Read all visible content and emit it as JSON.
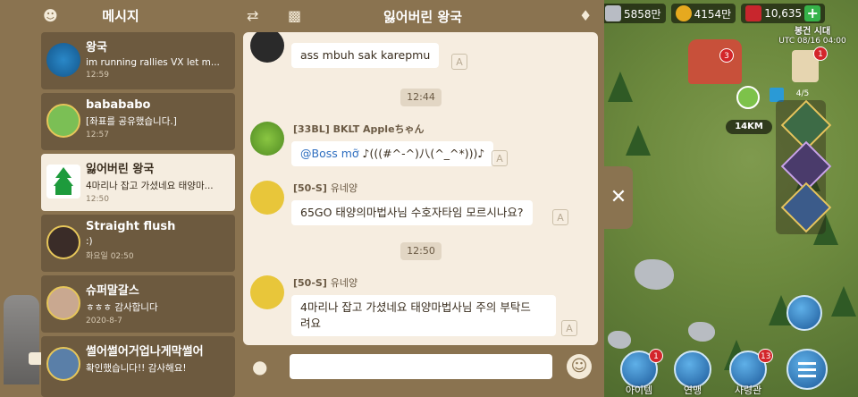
{
  "left_panel": {
    "title": "메시지",
    "conversations": [
      {
        "name": "왕국",
        "preview": "im running rallies VX let m...",
        "time": "12:59"
      },
      {
        "name": "babababo",
        "preview": "[좌표를 공유했습니다.]",
        "time": "12:57"
      },
      {
        "name": "잃어버린 왕국",
        "preview": "4마리나 잡고 가셨네요 태양마...",
        "time": "12:50"
      },
      {
        "name": "Straight flush",
        "preview": ":)",
        "time": "화요일 02:50"
      },
      {
        "name": "슈퍼말갈스",
        "preview": "ㅎㅎㅎ 감사합니다",
        "time": "2020-8-7"
      },
      {
        "name": "썰어썰어거업나게막썰어",
        "preview": "확인했습니다!! 감사해요!",
        "time": ""
      }
    ]
  },
  "chat": {
    "title": "잃어버린 왕국",
    "messages": [
      {
        "sender_tag": "",
        "sender_name": "",
        "text": "ass mbuh sak karepmu"
      },
      {
        "sender_tag": "[33BL]",
        "sender_name": "BKLT Appleちゃん",
        "mention": "@Boss mỡ",
        "text": " ♪(((#^-^)八(^_^*)))♪"
      },
      {
        "sender_tag": "[50-S]",
        "sender_name": "유네양",
        "text": "65GO 태양의마법사님 수호자타임 모르시나요?"
      },
      {
        "sender_tag": "[50-S]",
        "sender_name": "유네양",
        "text_line1": "4마리나 잡고 가셨네요 태양마법사님 주의 부탁드",
        "text_line2": "려요"
      }
    ],
    "time_separators": [
      "12:44",
      "12:50"
    ],
    "input_placeholder": ""
  },
  "resources": {
    "stone": "5858만",
    "gold": "4154만",
    "gems": "10,635"
  },
  "era": {
    "label": "봉건 시대",
    "time": "UTC 08/16 04:00"
  },
  "map": {
    "march_distance": "14KM",
    "march_count": "4/5",
    "building_badge": "3",
    "quest_badge": "1"
  },
  "bottom_buttons": [
    {
      "label": "아이템",
      "badge": "1"
    },
    {
      "label": "연맹",
      "badge": ""
    },
    {
      "label": "사령관",
      "badge": "13"
    },
    {
      "label": "",
      "badge": ""
    }
  ],
  "colors": {
    "panel_brown": "#8a7350",
    "chat_bg": "#f6ede0",
    "mention_blue": "#2f6fc0",
    "gem_red": "#c8262d",
    "plus_green": "#36b34a"
  }
}
